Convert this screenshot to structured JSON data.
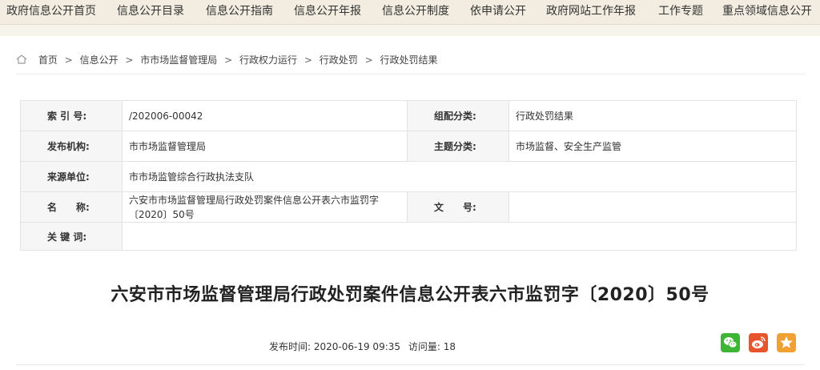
{
  "nav": {
    "items": [
      "政府信息公开首页",
      "信息公开目录",
      "信息公开指南",
      "信息公开年报",
      "信息公开制度",
      "依申请公开",
      "政府网站工作年报",
      "工作专题",
      "重点领域信息公开"
    ]
  },
  "breadcrumb": {
    "items": [
      "首页",
      "信息公开",
      "市市场监督管理局",
      "行政权力运行",
      "行政处罚",
      "行政处罚结果"
    ],
    "separator": ">"
  },
  "meta": {
    "index_label": "索 引 号:",
    "index_value": "/202006-00042",
    "category_label": "组配分类:",
    "category_value": "行政处罚结果",
    "publisher_label": "发布机构:",
    "publisher_value": "市市场监督管理局",
    "topic_label": "主题分类:",
    "topic_value": "市场监督、安全生产监管",
    "source_label": "来源单位:",
    "source_value": "市市场监管综合行政执法支队",
    "name_label": "名　　称:",
    "name_value": "六安市市场监督管理局行政处罚案件信息公开表六市监罚字〔2020〕50号",
    "docno_label": "文　　号:",
    "docno_value": "",
    "keywords_label": "关 键 词:",
    "keywords_value": ""
  },
  "article": {
    "title": "六安市市场监督管理局行政处罚案件信息公开表六市监罚字〔2020〕50号",
    "publish_label": "发布时间:",
    "publish_time": "2020-06-19 09:35",
    "views_label": "访问量:",
    "views": "18"
  },
  "share": {
    "wechat_color": "#3fb536",
    "weibo_color": "#e8542c",
    "favorite_color": "#f0a132",
    "icons": [
      "wechat-icon",
      "weibo-icon",
      "star-icon"
    ]
  }
}
